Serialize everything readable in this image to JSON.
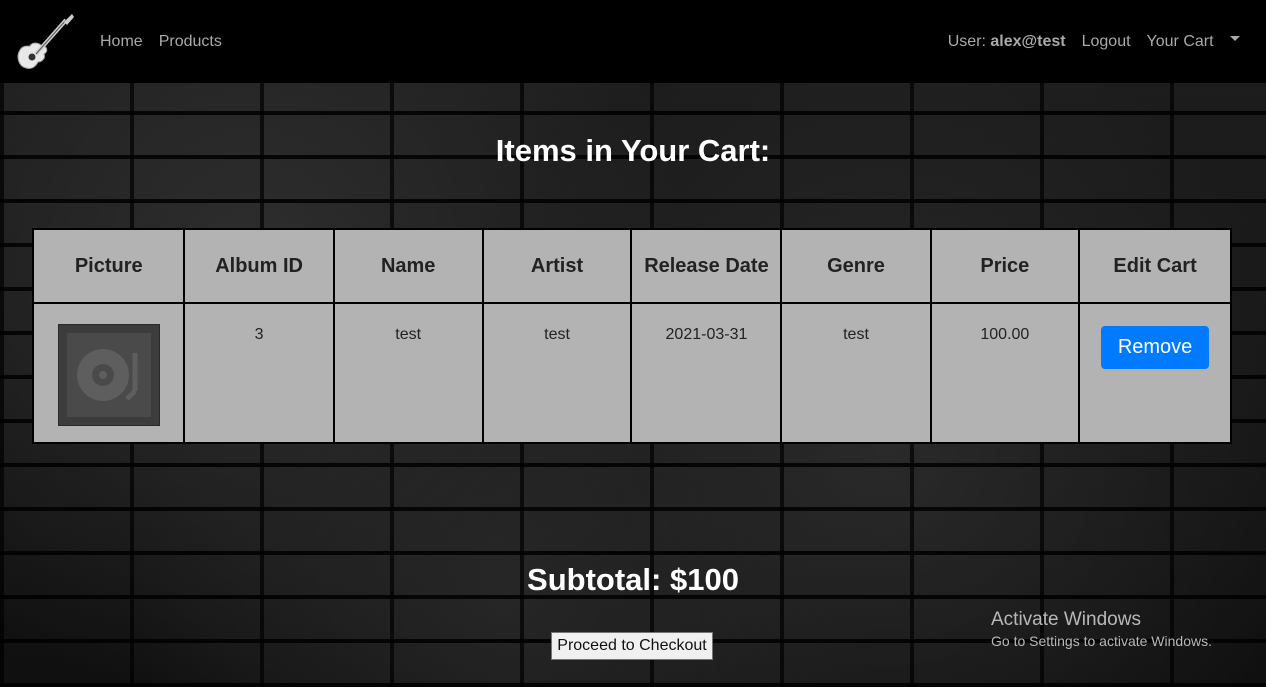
{
  "nav": {
    "brand_icon": "guitar-icon",
    "links": [
      "Home",
      "Products"
    ],
    "user_prefix": "User:",
    "user_email": "alex@test",
    "logout": "Logout",
    "cart": "Your Cart"
  },
  "page": {
    "title": "Items in Your Cart:",
    "subtotal": "Subtotal: $100",
    "checkout_label": "Proceed to Checkout"
  },
  "table": {
    "headers": [
      "Picture",
      "Album ID",
      "Name",
      "Artist",
      "Release Date",
      "Genre",
      "Price",
      "Edit Cart"
    ],
    "rows": [
      {
        "picture_icon": "turntable-icon",
        "album_id": "3",
        "name": "test",
        "artist": "test",
        "release_date": "2021-03-31",
        "genre": "test",
        "price": "100.00",
        "action": "Remove"
      }
    ]
  },
  "watermark": {
    "title": "Activate Windows",
    "subtitle": "Go to Settings to activate Windows."
  },
  "colors": {
    "navbar": "#000000",
    "table_bg": "#b3b3b3",
    "remove_button": "#007bff"
  }
}
